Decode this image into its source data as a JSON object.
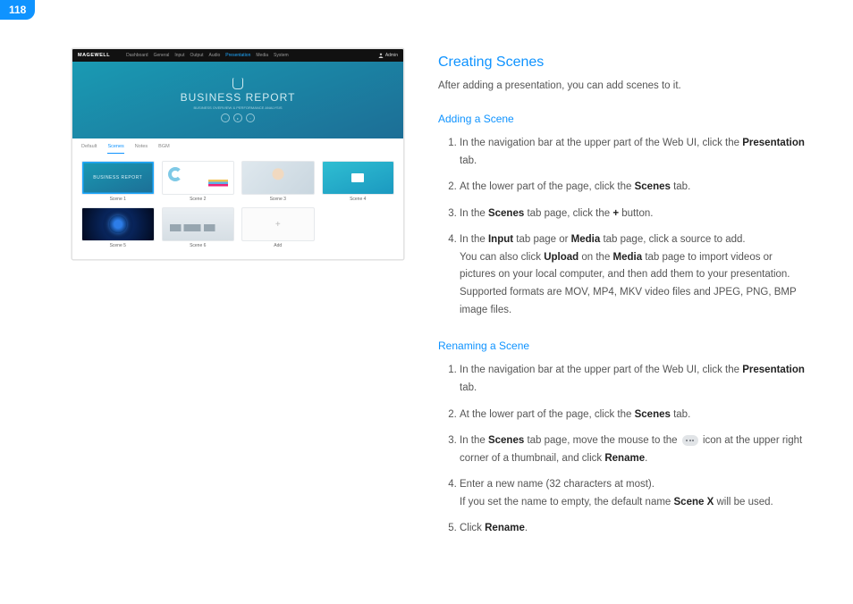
{
  "page_number": "118",
  "screenshot": {
    "logo": "MAGEWELL",
    "nav": [
      "Dashboard",
      "General",
      "Input",
      "Output",
      "Audio",
      "Presentation",
      "Media",
      "System"
    ],
    "nav_active_index": 5,
    "user": "Admin",
    "hero_title": "BUSINESS REPORT",
    "hero_sub": "BUSINESS OVERVIEW & PERFORMANCE ANALYSIS",
    "tabs": [
      "Default",
      "Scenes",
      "Notes",
      "BGM"
    ],
    "tab_active_index": 1,
    "row1": [
      "Scene 1",
      "Scene 2",
      "Scene 3",
      "Scene 4"
    ],
    "row2": [
      "Scene 5",
      "Scene 6",
      "Add",
      ""
    ],
    "tile1_text": "BUSINESS REPORT",
    "add_glyph": "+"
  },
  "title": "Creating Scenes",
  "intro": "After adding a presentation, you can add scenes to it.",
  "section1": {
    "heading": "Adding a Scene",
    "s1a": "In the navigation bar at the upper part of the Web UI, click the ",
    "s1b": "Presentation",
    "s1c": " tab.",
    "s2a": "At the lower part of the page, click the ",
    "s2b": "Scenes",
    "s2c": " tab.",
    "s3a": "In the ",
    "s3b": "Scenes",
    "s3c": " tab page, click the ",
    "s3d": "+",
    "s3e": " button.",
    "s4a": "In the ",
    "s4b": "Input",
    "s4c": " tab page or ",
    "s4d": "Media",
    "s4e": " tab page, click a source to add.",
    "s4f": "You can also click ",
    "s4g": "Upload",
    "s4h": " on the ",
    "s4i": "Media",
    "s4j": " tab page to import videos or pictures on your local computer, and then add them to your presentation. Supported formats are MOV, MP4, MKV video files and JPEG, PNG, BMP image files."
  },
  "section2": {
    "heading": "Renaming a Scene",
    "s1a": "In the navigation bar at the upper part of the Web UI, click the ",
    "s1b": "Presentation",
    "s1c": " tab.",
    "s2a": "At the lower part of the page, click the ",
    "s2b": "Scenes",
    "s2c": " tab.",
    "s3a": "In the ",
    "s3b": "Scenes",
    "s3c": " tab page, move the mouse to the ",
    "s3d": " icon at the upper right corner of a thumbnail, and click ",
    "s3e": "Rename",
    "s3f": ".",
    "s4a": "Enter a new name (32 characters at most).",
    "s4b": "If you set the name to empty, the default name ",
    "s4c": "Scene X",
    "s4d": " will be used.",
    "s5a": "Click ",
    "s5b": "Rename",
    "s5c": "."
  }
}
